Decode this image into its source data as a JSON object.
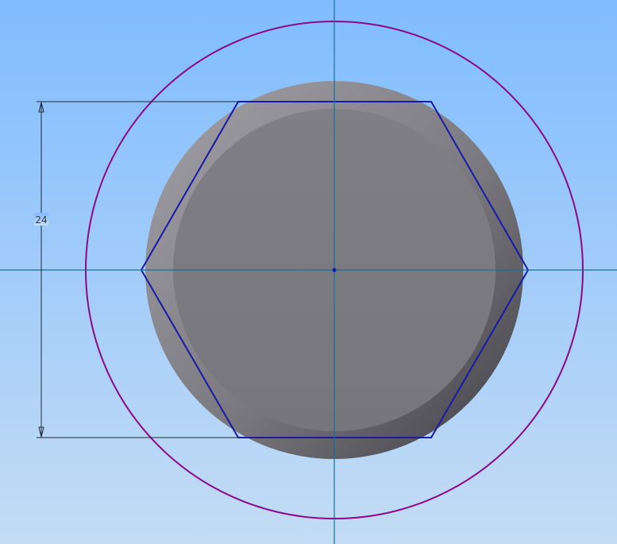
{
  "viewport": {
    "background_top": "#80bcff",
    "background_bottom": "#c4dcf4"
  },
  "sketch": {
    "dimension_label": "24",
    "colors": {
      "centerline": "#1a6f9a",
      "hexagon": "#1a1aa8",
      "outer_circle": "#8a0a8a",
      "dimension": "#202a38",
      "part_light": "#9a9aa0",
      "part_dark": "#4a4a50",
      "face": "#7c7c82"
    }
  }
}
